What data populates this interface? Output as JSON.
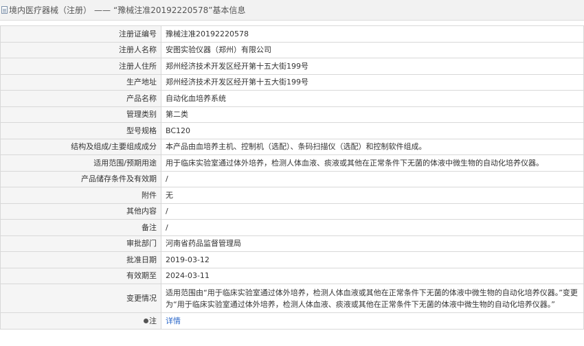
{
  "header": {
    "section": "境内医疗器械（注册）",
    "separator": "——",
    "record_title": "“豫械注准20192220578”基本信息"
  },
  "rows": [
    {
      "label": "注册证编号",
      "value": "豫械注准20192220578"
    },
    {
      "label": "注册人名称",
      "value": "安图实验仪器（郑州）有限公司"
    },
    {
      "label": "注册人住所",
      "value": "郑州经济技术开发区经开第十五大街199号"
    },
    {
      "label": "生产地址",
      "value": "郑州经济技术开发区经开第十五大街199号"
    },
    {
      "label": "产品名称",
      "value": "自动化血培养系统"
    },
    {
      "label": "管理类别",
      "value": "第二类"
    },
    {
      "label": "型号规格",
      "value": "BC120"
    },
    {
      "label": "结构及组成/主要组成成分",
      "value": "本产品由血培养主机、控制机（选配）、条码扫描仪（选配）和控制软件组成。"
    },
    {
      "label": "适用范围/预期用途",
      "value": "用于临床实验室通过体外培养，检测人体血液、痰液或其他在正常条件下无菌的体液中微生物的自动化培养仪器。"
    },
    {
      "label": "产品储存条件及有效期",
      "value": "/"
    },
    {
      "label": "附件",
      "value": "无"
    },
    {
      "label": "其他内容",
      "value": "/"
    },
    {
      "label": "备注",
      "value": "/"
    },
    {
      "label": "审批部门",
      "value": "河南省药品监督管理局"
    },
    {
      "label": "批准日期",
      "value": "2019-03-12"
    },
    {
      "label": "有效期至",
      "value": "2024-03-11"
    },
    {
      "label": "变更情况",
      "value": "适用范围由“用于临床实验室通过体外培养，检测人体血液或其他在正常条件下无菌的体液中微生物的自动化培养仪器。”变更为“用于临床实验室通过体外培养，检测人体血液、痰液或其他在正常条件下无菌的体液中微生物的自动化培养仪器。”"
    }
  ],
  "note_row": {
    "label": "注",
    "link": "详情",
    "icon": "note-icon"
  }
}
